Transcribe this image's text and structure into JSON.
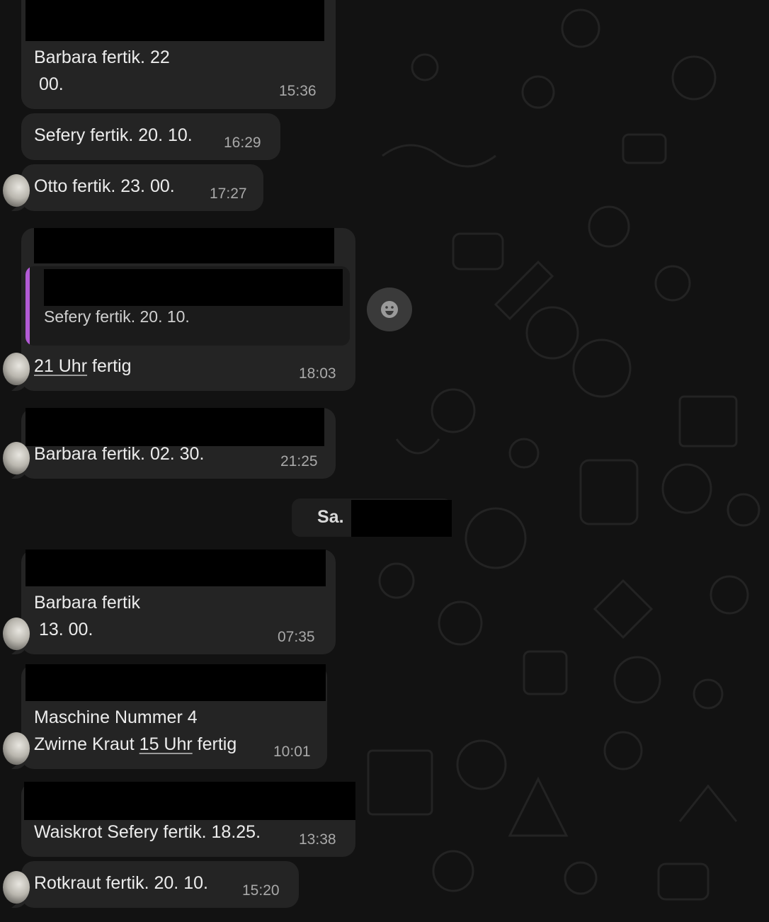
{
  "messages": [
    {
      "lines": [
        "Barbara fertik. 22",
        " 00."
      ],
      "time": "15:36"
    },
    {
      "lines": [
        "Sefery fertik. 20. 10."
      ],
      "time": "16:29"
    },
    {
      "lines": [
        "Otto fertik. 23. 00."
      ],
      "time": "17:27"
    },
    {
      "quote": "Sefery fertik. 20. 10.",
      "pre": "",
      "link": "21 Uhr",
      "post": " fertig",
      "time": "18:03"
    },
    {
      "lines": [
        "Barbara fertik. 02. 30."
      ],
      "time": "21:25"
    },
    {
      "lines": [
        "Barbara fertik",
        " 13. 00."
      ],
      "time": "07:35"
    },
    {
      "line1": "Maschine Nummer 4",
      "pre": "Zwirne Kraut ",
      "link": "15 Uhr",
      "post": " fertig",
      "time": "10:01"
    },
    {
      "lines": [
        "Waiskrot Sefery fertik. 18.25."
      ],
      "time": "13:38"
    },
    {
      "lines": [
        "Rotkraut fertik. 20. 10."
      ],
      "time": "15:20"
    }
  ],
  "date_separator": {
    "label": "Sa."
  },
  "icons": {
    "reaction": "emoji-smile-icon",
    "avatar": "contact-avatar"
  },
  "colors": {
    "background": "#121212",
    "bubble": "#242424",
    "quote_accent": "#b35bd6",
    "time": "#a9a9a9"
  }
}
